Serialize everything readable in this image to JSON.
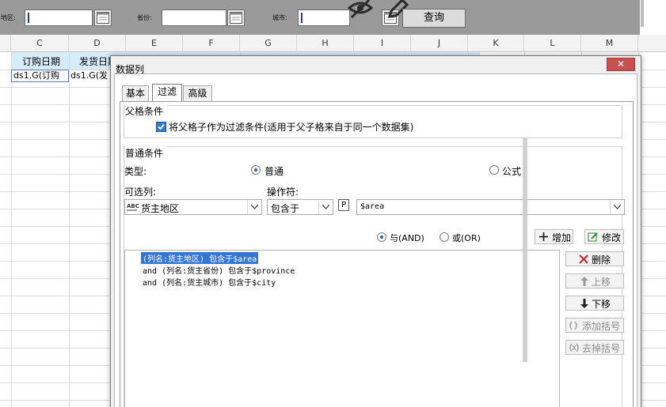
{
  "params": {
    "region_label": "地区:",
    "province_label": "省份:",
    "city_label": "城市:",
    "query_button": "查询",
    "icons": [
      "calendar-icon",
      "calendar-icon",
      "calendar-icon",
      "hide-icon",
      "edit-icon"
    ]
  },
  "grid": {
    "columns": [
      "C",
      "D",
      "E",
      "F",
      "G",
      "H",
      "I",
      "J",
      "K",
      "L",
      "M"
    ],
    "row1": [
      "订购日期",
      "发货日期"
    ],
    "row2": [
      "ds1.G(订购",
      "ds1.G(发"
    ]
  },
  "dialog": {
    "title": "数据列",
    "close": "✕",
    "tabs": [
      "基本",
      "过滤",
      "高级"
    ],
    "active_tab": "过滤",
    "parent_group_title": "父格条件",
    "parent_checkbox_label": "将父格子作为过滤条件(适用于父子格来自于同一个数据集)",
    "parent_checkbox_checked": true,
    "normal_group_title": "普通条件",
    "type_label": "类型:",
    "type_options": [
      "普通",
      "公式"
    ],
    "type_selected": "普通",
    "column_label": "可选列:",
    "operator_label": "操作符:",
    "column_value": "货主地区",
    "operator_value": "包含于",
    "value_field": "$area",
    "logic_options": [
      "与(AND)",
      "或(OR)"
    ],
    "logic_selected": "与(AND)",
    "add_button": "增加",
    "modify_button": "修改",
    "conditions": [
      "(列名:货主地区) 包含于$area",
      "and (列名:货主省份) 包含于$province",
      "and (列名:货主城市) 包含于$city"
    ],
    "delete_button": "删除",
    "up_button": "上移",
    "down_button": "下移",
    "add_bracket_button": "添加括号",
    "remove_bracket_button": "去掉括号"
  },
  "colors": {
    "param_bar": "#9a9a9a",
    "selection": "#3476d6",
    "close_button": "#c75050",
    "row_highlight": "#d6ecfa"
  }
}
